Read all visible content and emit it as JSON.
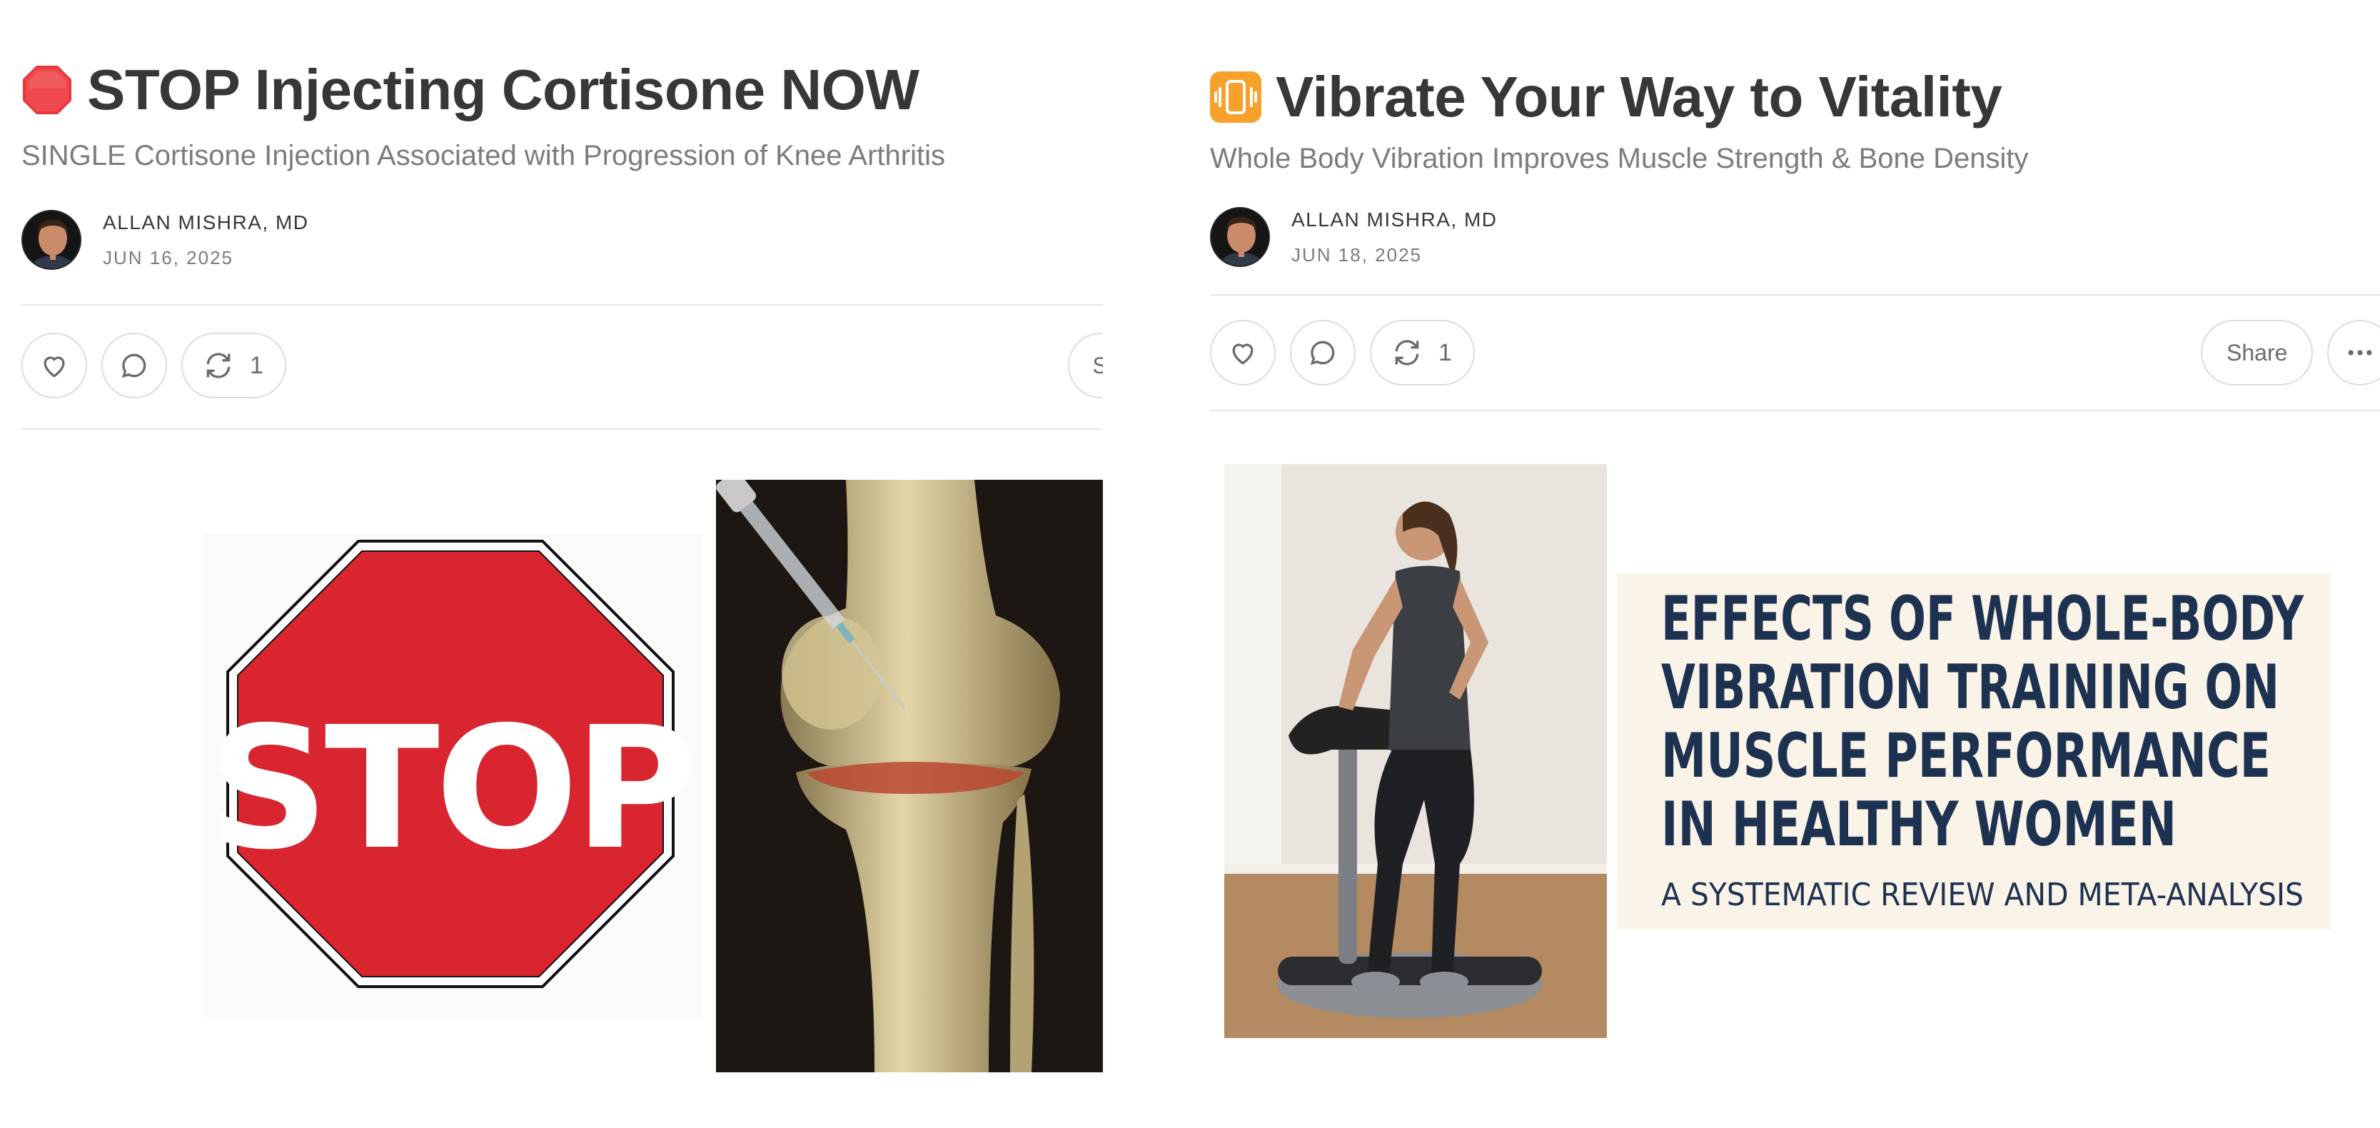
{
  "posts": [
    {
      "emoji": "stop-sign-icon",
      "title": "STOP Injecting Cortisone NOW",
      "subtitle": "SINGLE Cortisone Injection Associated with Progression of Knee Arthritis",
      "author": "ALLAN MISHRA, MD",
      "date": "JUN 16, 2025",
      "restack_count": "1",
      "share_label_partial": "S",
      "image": {
        "stop_text": "STOP"
      }
    },
    {
      "emoji": "vibration-mode-icon",
      "title": "Vibrate Your Way to Vitality",
      "subtitle": "Whole Body Vibration Improves Muscle Strength & Bone Density",
      "author": "ALLAN MISHRA, MD",
      "date": "JUN 18, 2025",
      "restack_count": "1",
      "share_label": "Share",
      "image": {
        "headline_lines": [
          "EFFECTS OF WHOLE-BODY",
          "VIBRATION TRAINING ON",
          "MUSCLE PERFORMANCE",
          "IN HEALTHY WOMEN"
        ],
        "subline": "A SYSTEMATIC REVIEW AND META-ANALYSIS"
      }
    }
  ],
  "colors": {
    "stop_red": "#d9252f",
    "emoji_orange": "#f7a12b",
    "headline_navy": "#1d3151",
    "cream": "#faf3e8"
  }
}
